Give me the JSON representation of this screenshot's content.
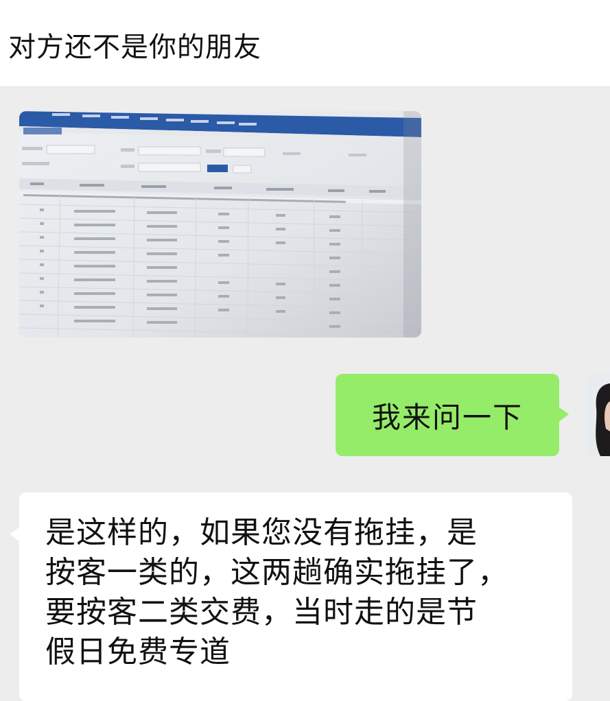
{
  "chat": {
    "notice": "对方还不是你的朋友",
    "sent_message": "我来问一下",
    "received_lines": [
      "是这样的，如果您没有拖挂，是",
      "按客一类的，这两趟确实拖挂了，",
      "要按客二类交费，当时走的是节",
      "假日免费专道"
    ]
  },
  "colors": {
    "sent_bubble": "#95ec69",
    "received_bubble": "#ffffff",
    "chat_background": "#ededed",
    "screenshot_nav": "#2b5aa7"
  },
  "icons": {
    "avatar": "user-avatar-photo",
    "image_message": "photo-of-monitor-screen"
  }
}
